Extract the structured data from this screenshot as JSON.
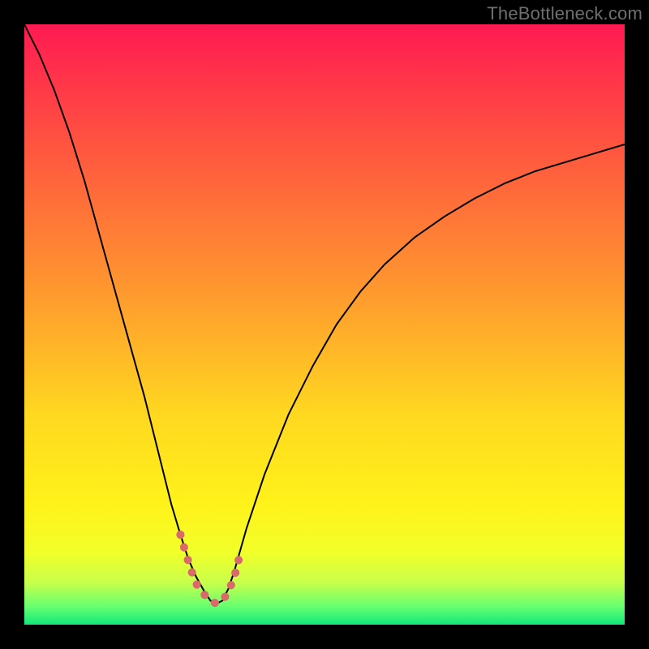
{
  "watermark": "TheBottleneck.com",
  "chart_data": {
    "type": "line",
    "title": "",
    "xlabel": "",
    "ylabel": "",
    "xlim": [
      0,
      100
    ],
    "ylim": [
      0,
      100
    ],
    "grid": false,
    "legend": false,
    "background_gradient_stops": [
      {
        "pos": 0.0,
        "color": "#ff1a52"
      },
      {
        "pos": 0.2,
        "color": "#ff5440"
      },
      {
        "pos": 0.45,
        "color": "#ff9a2e"
      },
      {
        "pos": 0.65,
        "color": "#ffd820"
      },
      {
        "pos": 0.8,
        "color": "#fff21a"
      },
      {
        "pos": 0.88,
        "color": "#f2ff2a"
      },
      {
        "pos": 0.93,
        "color": "#c8ff4a"
      },
      {
        "pos": 0.97,
        "color": "#66ff70"
      },
      {
        "pos": 1.0,
        "color": "#12e87a"
      }
    ],
    "series": [
      {
        "name": "bottleneck-curve",
        "color": "#000000",
        "stroke_width": 2,
        "x": [
          0.0,
          2.5,
          5.0,
          7.5,
          10.0,
          12.5,
          15.0,
          17.5,
          20.0,
          21.5,
          23.0,
          24.5,
          26.0,
          27.3,
          28.6,
          30.0,
          31.0,
          32.0,
          33.0,
          34.0,
          35.0,
          37.0,
          40.0,
          44.0,
          48.0,
          52.0,
          56.0,
          60.0,
          65.0,
          70.0,
          75.0,
          80.0,
          85.0,
          90.0,
          95.0,
          100.0
        ],
        "y": [
          100.0,
          95.0,
          89.0,
          82.0,
          74.0,
          65.0,
          56.0,
          47.0,
          38.0,
          32.0,
          26.0,
          20.0,
          15.0,
          11.0,
          8.0,
          5.5,
          4.0,
          3.5,
          4.0,
          6.0,
          9.0,
          16.0,
          25.0,
          35.0,
          43.0,
          50.0,
          55.5,
          60.0,
          64.5,
          68.0,
          71.0,
          73.5,
          75.5,
          77.0,
          78.5,
          80.0
        ]
      },
      {
        "name": "valley-highlight",
        "color": "#d96a6a",
        "stroke_width": 10,
        "linecap": "round",
        "dash": "0.2 16",
        "x": [
          26.0,
          27.0,
          28.0,
          29.0,
          30.0,
          31.0,
          32.0,
          33.0,
          34.0,
          35.0,
          36.0
        ],
        "y": [
          15.0,
          11.5,
          8.5,
          6.0,
          5.0,
          4.0,
          3.5,
          4.0,
          5.5,
          8.0,
          12.0
        ]
      }
    ]
  }
}
